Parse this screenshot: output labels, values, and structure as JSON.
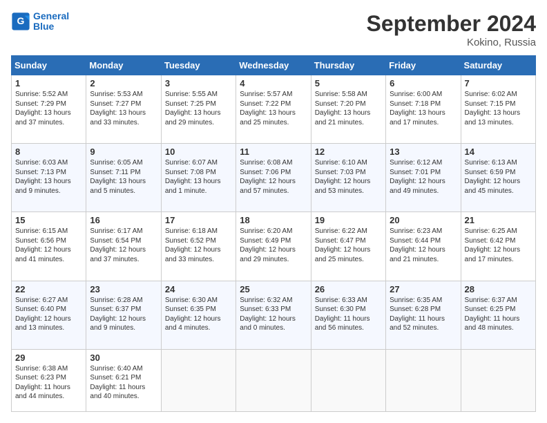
{
  "header": {
    "logo_line1": "General",
    "logo_line2": "Blue",
    "title": "September 2024",
    "subtitle": "Kokino, Russia"
  },
  "weekdays": [
    "Sunday",
    "Monday",
    "Tuesday",
    "Wednesday",
    "Thursday",
    "Friday",
    "Saturday"
  ],
  "rows": [
    [
      {
        "day": "1",
        "lines": [
          "Sunrise: 5:52 AM",
          "Sunset: 7:29 PM",
          "Daylight: 13 hours",
          "and 37 minutes."
        ]
      },
      {
        "day": "2",
        "lines": [
          "Sunrise: 5:53 AM",
          "Sunset: 7:27 PM",
          "Daylight: 13 hours",
          "and 33 minutes."
        ]
      },
      {
        "day": "3",
        "lines": [
          "Sunrise: 5:55 AM",
          "Sunset: 7:25 PM",
          "Daylight: 13 hours",
          "and 29 minutes."
        ]
      },
      {
        "day": "4",
        "lines": [
          "Sunrise: 5:57 AM",
          "Sunset: 7:22 PM",
          "Daylight: 13 hours",
          "and 25 minutes."
        ]
      },
      {
        "day": "5",
        "lines": [
          "Sunrise: 5:58 AM",
          "Sunset: 7:20 PM",
          "Daylight: 13 hours",
          "and 21 minutes."
        ]
      },
      {
        "day": "6",
        "lines": [
          "Sunrise: 6:00 AM",
          "Sunset: 7:18 PM",
          "Daylight: 13 hours",
          "and 17 minutes."
        ]
      },
      {
        "day": "7",
        "lines": [
          "Sunrise: 6:02 AM",
          "Sunset: 7:15 PM",
          "Daylight: 13 hours",
          "and 13 minutes."
        ]
      }
    ],
    [
      {
        "day": "8",
        "lines": [
          "Sunrise: 6:03 AM",
          "Sunset: 7:13 PM",
          "Daylight: 13 hours",
          "and 9 minutes."
        ]
      },
      {
        "day": "9",
        "lines": [
          "Sunrise: 6:05 AM",
          "Sunset: 7:11 PM",
          "Daylight: 13 hours",
          "and 5 minutes."
        ]
      },
      {
        "day": "10",
        "lines": [
          "Sunrise: 6:07 AM",
          "Sunset: 7:08 PM",
          "Daylight: 13 hours",
          "and 1 minute."
        ]
      },
      {
        "day": "11",
        "lines": [
          "Sunrise: 6:08 AM",
          "Sunset: 7:06 PM",
          "Daylight: 12 hours",
          "and 57 minutes."
        ]
      },
      {
        "day": "12",
        "lines": [
          "Sunrise: 6:10 AM",
          "Sunset: 7:03 PM",
          "Daylight: 12 hours",
          "and 53 minutes."
        ]
      },
      {
        "day": "13",
        "lines": [
          "Sunrise: 6:12 AM",
          "Sunset: 7:01 PM",
          "Daylight: 12 hours",
          "and 49 minutes."
        ]
      },
      {
        "day": "14",
        "lines": [
          "Sunrise: 6:13 AM",
          "Sunset: 6:59 PM",
          "Daylight: 12 hours",
          "and 45 minutes."
        ]
      }
    ],
    [
      {
        "day": "15",
        "lines": [
          "Sunrise: 6:15 AM",
          "Sunset: 6:56 PM",
          "Daylight: 12 hours",
          "and 41 minutes."
        ]
      },
      {
        "day": "16",
        "lines": [
          "Sunrise: 6:17 AM",
          "Sunset: 6:54 PM",
          "Daylight: 12 hours",
          "and 37 minutes."
        ]
      },
      {
        "day": "17",
        "lines": [
          "Sunrise: 6:18 AM",
          "Sunset: 6:52 PM",
          "Daylight: 12 hours",
          "and 33 minutes."
        ]
      },
      {
        "day": "18",
        "lines": [
          "Sunrise: 6:20 AM",
          "Sunset: 6:49 PM",
          "Daylight: 12 hours",
          "and 29 minutes."
        ]
      },
      {
        "day": "19",
        "lines": [
          "Sunrise: 6:22 AM",
          "Sunset: 6:47 PM",
          "Daylight: 12 hours",
          "and 25 minutes."
        ]
      },
      {
        "day": "20",
        "lines": [
          "Sunrise: 6:23 AM",
          "Sunset: 6:44 PM",
          "Daylight: 12 hours",
          "and 21 minutes."
        ]
      },
      {
        "day": "21",
        "lines": [
          "Sunrise: 6:25 AM",
          "Sunset: 6:42 PM",
          "Daylight: 12 hours",
          "and 17 minutes."
        ]
      }
    ],
    [
      {
        "day": "22",
        "lines": [
          "Sunrise: 6:27 AM",
          "Sunset: 6:40 PM",
          "Daylight: 12 hours",
          "and 13 minutes."
        ]
      },
      {
        "day": "23",
        "lines": [
          "Sunrise: 6:28 AM",
          "Sunset: 6:37 PM",
          "Daylight: 12 hours",
          "and 9 minutes."
        ]
      },
      {
        "day": "24",
        "lines": [
          "Sunrise: 6:30 AM",
          "Sunset: 6:35 PM",
          "Daylight: 12 hours",
          "and 4 minutes."
        ]
      },
      {
        "day": "25",
        "lines": [
          "Sunrise: 6:32 AM",
          "Sunset: 6:33 PM",
          "Daylight: 12 hours",
          "and 0 minutes."
        ]
      },
      {
        "day": "26",
        "lines": [
          "Sunrise: 6:33 AM",
          "Sunset: 6:30 PM",
          "Daylight: 11 hours",
          "and 56 minutes."
        ]
      },
      {
        "day": "27",
        "lines": [
          "Sunrise: 6:35 AM",
          "Sunset: 6:28 PM",
          "Daylight: 11 hours",
          "and 52 minutes."
        ]
      },
      {
        "day": "28",
        "lines": [
          "Sunrise: 6:37 AM",
          "Sunset: 6:25 PM",
          "Daylight: 11 hours",
          "and 48 minutes."
        ]
      }
    ],
    [
      {
        "day": "29",
        "lines": [
          "Sunrise: 6:38 AM",
          "Sunset: 6:23 PM",
          "Daylight: 11 hours",
          "and 44 minutes."
        ]
      },
      {
        "day": "30",
        "lines": [
          "Sunrise: 6:40 AM",
          "Sunset: 6:21 PM",
          "Daylight: 11 hours",
          "and 40 minutes."
        ]
      },
      {
        "day": "",
        "lines": []
      },
      {
        "day": "",
        "lines": []
      },
      {
        "day": "",
        "lines": []
      },
      {
        "day": "",
        "lines": []
      },
      {
        "day": "",
        "lines": []
      }
    ]
  ]
}
